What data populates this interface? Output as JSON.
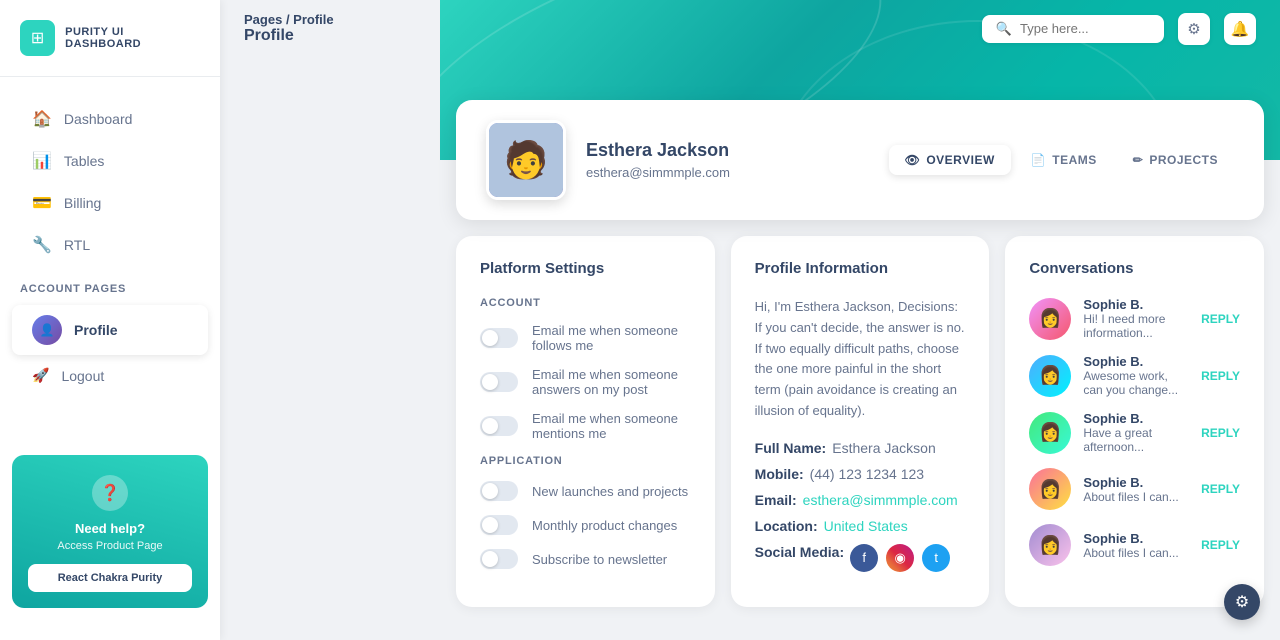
{
  "app": {
    "name": "PURITY UI DASHBOARD"
  },
  "sidebar": {
    "nav_items": [
      {
        "id": "dashboard",
        "label": "Dashboard",
        "icon": "🏠",
        "active": false
      },
      {
        "id": "tables",
        "label": "Tables",
        "icon": "📊",
        "active": false
      },
      {
        "id": "billing",
        "label": "Billing",
        "icon": "💳",
        "active": false
      },
      {
        "id": "rtl",
        "label": "RTL",
        "icon": "🔧",
        "active": false
      }
    ],
    "section_label": "ACCOUNT PAGES",
    "account_items": [
      {
        "id": "profile",
        "label": "Profile",
        "icon": "👤",
        "active": true
      },
      {
        "id": "logout",
        "label": "Logout",
        "icon": "🚀",
        "active": false
      }
    ],
    "help": {
      "title": "Need help?",
      "subtitle": "Access Product Page",
      "button_label": "React Chakra Purity"
    }
  },
  "topbar": {
    "breadcrumb_pages": "Pages",
    "breadcrumb_separator": "/",
    "breadcrumb_current": "Profile",
    "page_title": "Profile",
    "search_placeholder": "Type here...",
    "search_icon": "🔍",
    "settings_icon": "⚙",
    "bell_icon": "🔔"
  },
  "profile_card": {
    "name": "Esthera Jackson",
    "email": "esthera@simmmple.com",
    "tabs": [
      {
        "id": "overview",
        "label": "OVERVIEW",
        "icon": "👁",
        "active": true
      },
      {
        "id": "teams",
        "label": "TEAMS",
        "icon": "📄",
        "active": false
      },
      {
        "id": "projects",
        "label": "PROJECTS",
        "icon": "✏",
        "active": false
      }
    ]
  },
  "platform_settings": {
    "title": "Platform Settings",
    "account_label": "ACCOUNT",
    "toggles_account": [
      {
        "id": "follows",
        "label": "Email me when someone follows me",
        "on": false
      },
      {
        "id": "answers",
        "label": "Email me when someone answers on my post",
        "on": false
      },
      {
        "id": "mentions",
        "label": "Email me when someone mentions me",
        "on": false
      }
    ],
    "application_label": "APPLICATION",
    "toggles_app": [
      {
        "id": "launches",
        "label": "New launches and projects",
        "on": false
      },
      {
        "id": "monthly",
        "label": "Monthly product changes",
        "on": false
      },
      {
        "id": "newsletter",
        "label": "Subscribe to newsletter",
        "on": false
      }
    ]
  },
  "profile_info": {
    "title": "Profile Information",
    "bio": "Hi, I'm Esthera Jackson, Decisions: If you can't decide, the answer is no. If two equally difficult paths, choose the one more painful in the short term (pain avoidance is creating an illusion of equality).",
    "fields": [
      {
        "label": "Full Name:",
        "value": "Esthera Jackson",
        "teal": false
      },
      {
        "label": "Mobile:",
        "value": "(44) 123 1234 123",
        "teal": false
      },
      {
        "label": "Email:",
        "value": "esthera@simmmple.com",
        "teal": true
      },
      {
        "label": "Location:",
        "value": "United States",
        "teal": true
      },
      {
        "label": "Social Media:",
        "value": "",
        "teal": false
      }
    ],
    "social": {
      "facebook": "f",
      "instagram": "◉",
      "twitter": "t"
    }
  },
  "conversations": {
    "title": "Conversations",
    "items": [
      {
        "name": "Sophie B.",
        "msg": "Hi! I need more information...",
        "reply": "REPLY",
        "av_class": "av1"
      },
      {
        "name": "Sophie B.",
        "msg": "Awesome work, can you change...",
        "reply": "REPLY",
        "av_class": "av2"
      },
      {
        "name": "Sophie B.",
        "msg": "Have a great afternoon...",
        "reply": "REPLY",
        "av_class": "av3"
      },
      {
        "name": "Sophie B.",
        "msg": "About files I can...",
        "reply": "REPLY",
        "av_class": "av4"
      },
      {
        "name": "Sophie B.",
        "msg": "About files I can...",
        "reply": "REPLY",
        "av_class": "av5"
      }
    ]
  }
}
